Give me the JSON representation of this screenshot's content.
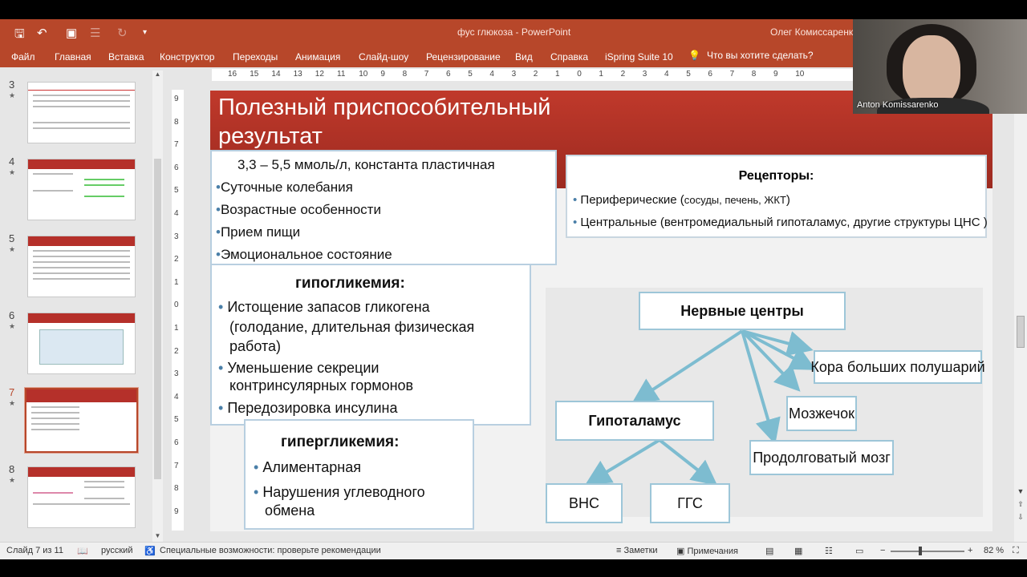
{
  "titlebar": {
    "doc_title": "фус глюкоза  -  PowerPoint",
    "user": "Олег Комиссаренко",
    "icons": [
      "save-icon",
      "undo-icon",
      "present-icon",
      "bullets-icon",
      "redo-icon",
      "customize-icon"
    ]
  },
  "ribbon": {
    "tabs": [
      "Файл",
      "Главная",
      "Вставка",
      "Конструктор",
      "Переходы",
      "Анимация",
      "Слайд-шоу",
      "Рецензирование",
      "Вид",
      "Справка",
      "iSpring Suite 10"
    ],
    "tell_me": "Что вы хотите сделать?"
  },
  "thumbnails": [
    {
      "num": "3",
      "star": "★"
    },
    {
      "num": "4",
      "star": "★"
    },
    {
      "num": "5",
      "star": "★"
    },
    {
      "num": "6",
      "star": "★"
    },
    {
      "num": "7",
      "star": "★"
    },
    {
      "num": "8",
      "star": "★"
    }
  ],
  "ruler_h": [
    "16",
    "15",
    "14",
    "13",
    "12",
    "11",
    "10",
    "9",
    "8",
    "7",
    "6",
    "5",
    "4",
    "3",
    "2",
    "1",
    "0",
    "1",
    "2",
    "3",
    "4",
    "5",
    "6",
    "7",
    "8",
    "9",
    "10"
  ],
  "ruler_v": [
    "9",
    "8",
    "7",
    "6",
    "5",
    "4",
    "3",
    "2",
    "1",
    "0",
    "1",
    "2",
    "3",
    "4",
    "5",
    "6",
    "7",
    "8",
    "9"
  ],
  "slide": {
    "title": "Полезный приспособительный результат",
    "glucose_box": {
      "headline": "3,3 – 5,5 ммоль/л, константа пластичная",
      "items": [
        "Суточные колебания",
        "Возрастные особенности",
        "Прием пищи",
        "Эмоциональное состояние"
      ]
    },
    "hypoglycemia": {
      "title": "гипогликемия:",
      "item1_l1": "Истощение запасов гликогена",
      "item1_l2": "(голодание,  длительная  физическая",
      "item1_l3": "работа)",
      "item2_l1": "Уменьшение секреции",
      "item2_l2": "контринсулярных гормонов",
      "item3": "Передозировка инсулина"
    },
    "hyperglycemia": {
      "title": "гипергликемия:",
      "item1": "Алиментарная",
      "item2_l1": "Нарушения углеводного",
      "item2_l2": "обмена"
    },
    "receptors": {
      "title": "Рецепторы:",
      "line1_a": "Периферические (",
      "line1_b": "сосуды,  печень,  ЖКТ",
      "line1_c": ")",
      "line2": "Центральные (вентромедиальный гипоталамус, другие структуры ЦНС )"
    },
    "diagram": {
      "centers": "Нервные центры",
      "cortex": "Кора больших полушарий",
      "cerebellum": "Мозжечок",
      "hypothalamus": "Гипоталамус",
      "medulla": "Продолговатый мозг",
      "ans": "ВНС",
      "ggs": "ГГС"
    }
  },
  "webcam": {
    "name": "Anton Komissarenko"
  },
  "statusbar": {
    "slide_info": "Слайд 7 из 11",
    "language": "русский",
    "accessibility": "Специальные возможности: проверьте рекомендации",
    "notes": "Заметки",
    "comments": "Примечания",
    "zoom": "82 %"
  }
}
